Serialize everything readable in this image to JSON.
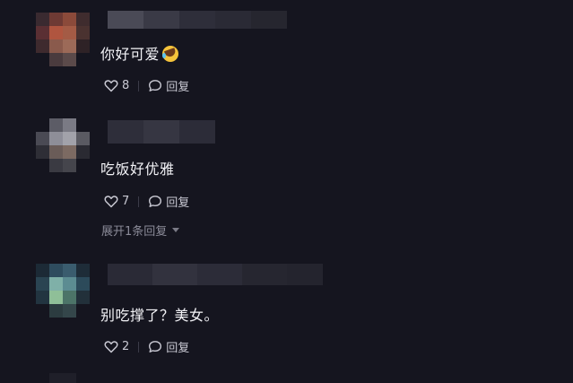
{
  "comments": [
    {
      "text": "你好可爱",
      "emoji": "rolling-on-floor-laughing-emoji",
      "likes": "8",
      "reply_label": "回复"
    },
    {
      "text": "吃饭好优雅",
      "likes": "7",
      "reply_label": "回复",
      "expand_label": "展开1条回复"
    },
    {
      "text": "别吃撑了？美女。",
      "likes": "2",
      "reply_label": "回复"
    }
  ],
  "icons": {
    "like": "heart-icon",
    "reply": "speech-bubble-icon",
    "expand": "caret-down-icon"
  },
  "colors": {
    "background": "#15151f",
    "text": "#f2f2f6",
    "secondary": "#8b8b98"
  }
}
